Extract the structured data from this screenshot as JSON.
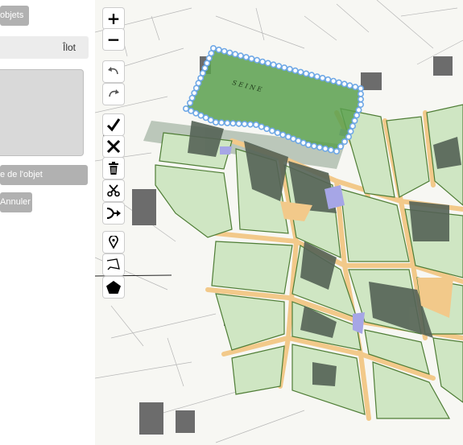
{
  "panel": {
    "objets_button": "objets",
    "tab_label": "Îlot",
    "type_button": "e de l'objet",
    "cancel_button": "Annuler"
  },
  "map_toolbar": {
    "zoom_in": "+",
    "zoom_out": "−"
  },
  "map": {
    "area_label": "S E I N E"
  },
  "colors": {
    "selected_polygon": "#5aa04e",
    "block_fill": "#cfe6c3",
    "street": "#f2c98a",
    "building": "#556356",
    "vertex": "#6fa8e6"
  }
}
